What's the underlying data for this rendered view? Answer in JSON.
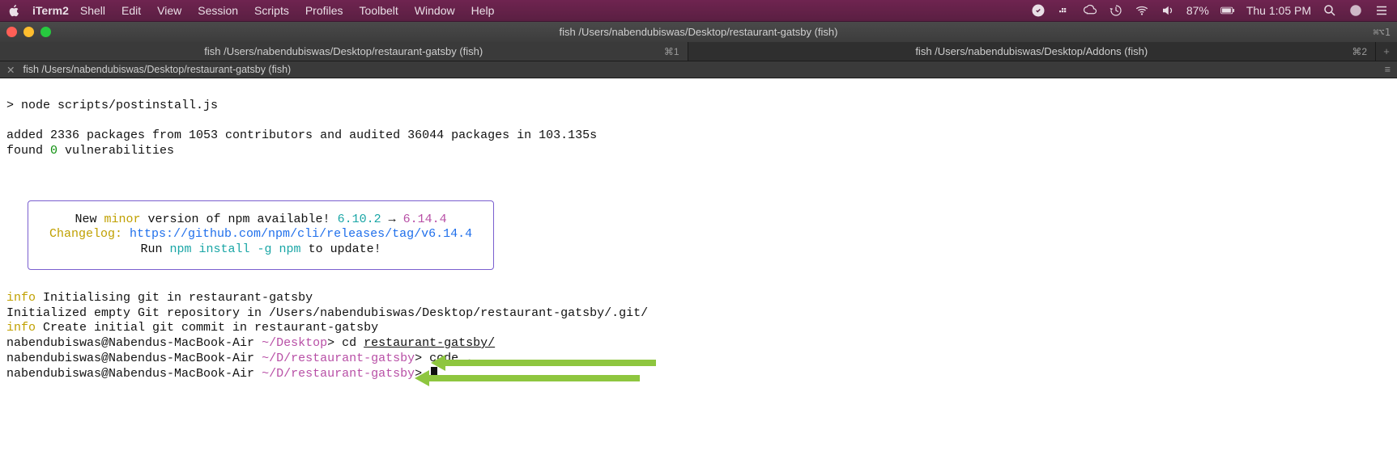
{
  "menubar": {
    "app": "iTerm2",
    "items": [
      "Shell",
      "Edit",
      "View",
      "Session",
      "Scripts",
      "Profiles",
      "Toolbelt",
      "Window",
      "Help"
    ],
    "battery": "87%",
    "clock": "Thu 1:05 PM"
  },
  "window": {
    "title": "fish /Users/nabendubiswas/Desktop/restaurant-gatsby (fish)",
    "right_badge": "⌘⌥1"
  },
  "tabs": [
    {
      "label": "fish /Users/nabendubiswas/Desktop/restaurant-gatsby (fish)",
      "shortcut": "⌘1",
      "active": true
    },
    {
      "label": "fish /Users/nabendubiswas/Desktop/Addons (fish)",
      "shortcut": "⌘2",
      "active": false
    }
  ],
  "pane": {
    "title": "fish /Users/nabendubiswas/Desktop/restaurant-gatsby (fish)"
  },
  "terminal": {
    "cmd1": "> node scripts/postinstall.js",
    "added_line": "added 2336 packages from 1053 contributors and audited 36044 packages in 103.135s",
    "vuln_prefix": "found ",
    "vuln_count": "0",
    "vuln_suffix": " vulnerabilities",
    "npm_box": {
      "l1a": "New ",
      "l1b": "minor",
      "l1c": " version of npm available! ",
      "l1d": "6.10.2",
      "l1e": " → ",
      "l1f": "6.14.4",
      "l2a": "Changelog:",
      "l2b": " ",
      "l2c": "https://github.com/npm/cli/releases/tag/v6.14.4",
      "l3a": "Run ",
      "l3b": "npm install -g npm",
      "l3c": " to update!"
    },
    "info": "info",
    "git1": " Initialising git in restaurant-gatsby",
    "git2": "Initialized empty Git repository in /Users/nabendubiswas/Desktop/restaurant-gatsby/.git/",
    "git3": " Create initial git commit in restaurant-gatsby",
    "prompt_user": "nabendubiswas@Nabendus-MacBook-Air",
    "prompt_path1": " ~/Desktop",
    "prompt_sep": "> ",
    "cmd_cd": "cd ",
    "cd_arg": "restaurant-gatsby/",
    "prompt_path2": " ~/D/restaurant-gatsby",
    "cmd_code": "code ",
    "code_arg": "."
  }
}
